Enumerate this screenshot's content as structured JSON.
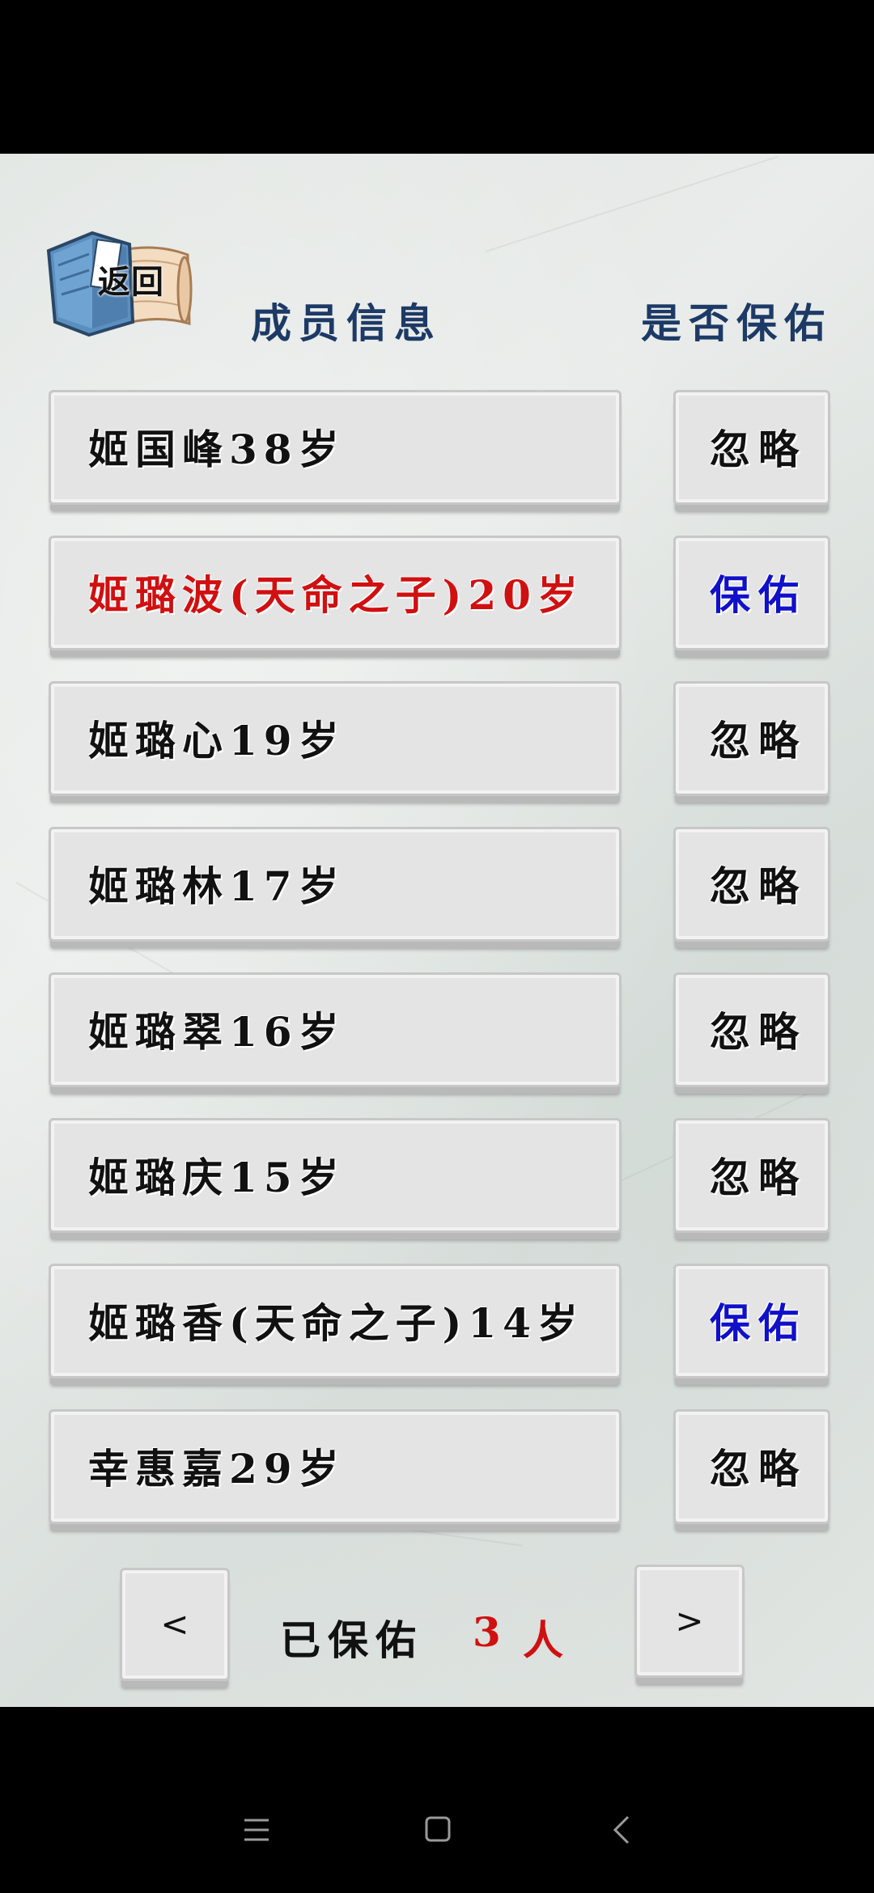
{
  "header": {
    "back_label": "返回",
    "col_member": "成员信息",
    "col_bless": "是否保佑"
  },
  "colors": {
    "normal_name": "#111111",
    "highlight_name": "#d01010",
    "ignore": "#111111",
    "bless": "#1010c8",
    "header": "#1d3a66"
  },
  "members": [
    {
      "name": "姬国峰38岁",
      "action": "忽略",
      "highlight": false
    },
    {
      "name": "姬璐波(天命之子)20岁",
      "action": "保佑",
      "highlight": true
    },
    {
      "name": "姬璐心19岁",
      "action": "忽略",
      "highlight": false
    },
    {
      "name": "姬璐林17岁",
      "action": "忽略",
      "highlight": false
    },
    {
      "name": "姬璐翠16岁",
      "action": "忽略",
      "highlight": false
    },
    {
      "name": "姬璐庆15岁",
      "action": "忽略",
      "highlight": false
    },
    {
      "name": "姬璐香(天命之子)14岁",
      "action": "保佑",
      "highlight": false
    },
    {
      "name": "幸惠嘉29岁",
      "action": "忽略",
      "highlight": false
    }
  ],
  "footer": {
    "prev_label": "<",
    "next_label": ">",
    "summary_label": "已保佑",
    "summary_count": "3",
    "summary_unit": "人"
  },
  "system_nav": {
    "icons": [
      "menu-icon",
      "home-icon",
      "back-icon"
    ]
  }
}
